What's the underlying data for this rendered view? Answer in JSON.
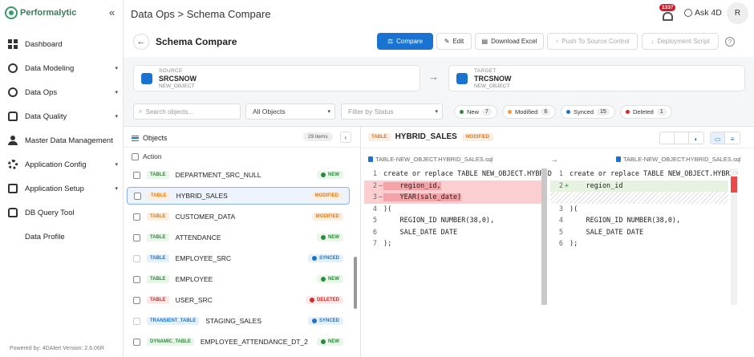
{
  "app": {
    "logo": "Performalytic",
    "collapse_icon": "chevron-double-left-icon"
  },
  "sidebar": {
    "items": [
      {
        "label": "Dashboard",
        "icon": "dashboard-icon",
        "caret": ""
      },
      {
        "label": "Data Modeling",
        "icon": "modeling-icon",
        "caret": "▾"
      },
      {
        "label": "Data Ops",
        "icon": "ops-icon",
        "caret": "▾"
      },
      {
        "label": "Data Quality",
        "icon": "quality-icon",
        "caret": "▾"
      },
      {
        "label": "Master Data Management",
        "icon": "mdm-icon",
        "caret": ""
      },
      {
        "label": "Application Config",
        "icon": "gear-icon",
        "caret": "▾"
      },
      {
        "label": "Application Setup",
        "icon": "setup-icon",
        "caret": "▾"
      },
      {
        "label": "DB Query Tool",
        "icon": "database-icon",
        "caret": ""
      },
      {
        "label": "Data Profile",
        "icon": "",
        "caret": ""
      }
    ],
    "footer": "Powered by: 4DAlert   Version: 2.6.06R"
  },
  "topbar": {
    "breadcrumb": "Data Ops  >  Schema Compare",
    "notifications": "1337",
    "ask": "Ask 4D",
    "avatar": "R"
  },
  "header": {
    "title": "Schema Compare",
    "buttons": {
      "compare": "Compare",
      "edit": "Edit",
      "download": "Download Excel",
      "push": "Push To Source Control",
      "deploy": "Deployment Script"
    },
    "help": "?"
  },
  "source": {
    "label": "SOURCE",
    "name": "SRCSNOW",
    "object": "NEW_OBJECT"
  },
  "target": {
    "label": "TARGET",
    "name": "TRCSNOW",
    "object": "NEW_OBJECT"
  },
  "filters": {
    "search_placeholder": "Search objects...",
    "object_select": "All Objects",
    "status_placeholder": "Filter by Status",
    "chips": [
      {
        "label": "New",
        "count": "7",
        "color": "#2e8b3a"
      },
      {
        "label": "Modified",
        "count": "6",
        "color": "#f0a030"
      },
      {
        "label": "Synced",
        "count": "15",
        "color": "#1a73d0"
      },
      {
        "label": "Deleted",
        "count": "1",
        "color": "#d12a2a"
      }
    ]
  },
  "objects": {
    "title": "Objects",
    "count": "29 items",
    "action_label": "Action",
    "rows": [
      {
        "type": "TABLE",
        "name": "DEPARTMENT_SRC_NULL",
        "status": "NEW"
      },
      {
        "type": "TABLE",
        "name": "HYBRID_SALES",
        "status": "MODIFIED"
      },
      {
        "type": "TABLE",
        "name": "CUSTOMER_DATA",
        "status": "MODIFIED"
      },
      {
        "type": "TABLE",
        "name": "ATTENDANCE",
        "status": "NEW"
      },
      {
        "type": "TABLE",
        "name": "EMPLOYEE_SRC",
        "status": "SYNCED"
      },
      {
        "type": "TABLE",
        "name": "EMPLOYEE",
        "status": "NEW"
      },
      {
        "type": "TABLE",
        "name": "USER_SRC",
        "status": "DELETED"
      },
      {
        "type": "TRANSIENT_TABLE",
        "name": "STAGING_SALES",
        "status": "SYNCED"
      },
      {
        "type": "DYNAMIC_TABLE",
        "name": "EMPLOYEE_ATTENDANCE_DT_2",
        "status": "NEW"
      }
    ]
  },
  "diff": {
    "type": "TABLE",
    "name": "HYBRID_SALES",
    "status": "MODIFIED",
    "left_file": "TABLE-NEW_OBJECT.HYBRID_SALES.sql",
    "right_file": "TABLE-NEW_OBJECT.HYBRID_SALES.sql",
    "arrow": "→",
    "left": [
      {
        "n": "1",
        "m": "",
        "text": "create or replace TABLE NEW_OBJECT.HYBRID"
      },
      {
        "n": "2",
        "m": "—",
        "text": "    region_id,"
      },
      {
        "n": "3",
        "m": "—",
        "text": "    YEAR(sale_date)"
      },
      {
        "n": "4",
        "m": "",
        "text": ")("
      },
      {
        "n": "5",
        "m": "",
        "text": "    REGION_ID NUMBER(38,0),"
      },
      {
        "n": "6",
        "m": "",
        "text": "    SALE_DATE DATE"
      },
      {
        "n": "7",
        "m": "",
        "text": ");"
      }
    ],
    "right": [
      {
        "n": "1",
        "m": "",
        "text": "create or replace TABLE NEW_OBJECT.HYBRID"
      },
      {
        "n": "2",
        "m": "+",
        "text": "    region_id"
      },
      {
        "n": "",
        "m": "",
        "text": ""
      },
      {
        "n": "3",
        "m": "",
        "text": ")("
      },
      {
        "n": "4",
        "m": "",
        "text": "    REGION_ID NUMBER(38,0),"
      },
      {
        "n": "5",
        "m": "",
        "text": "    SALE_DATE DATE"
      },
      {
        "n": "6",
        "m": "",
        "text": ");"
      }
    ]
  }
}
